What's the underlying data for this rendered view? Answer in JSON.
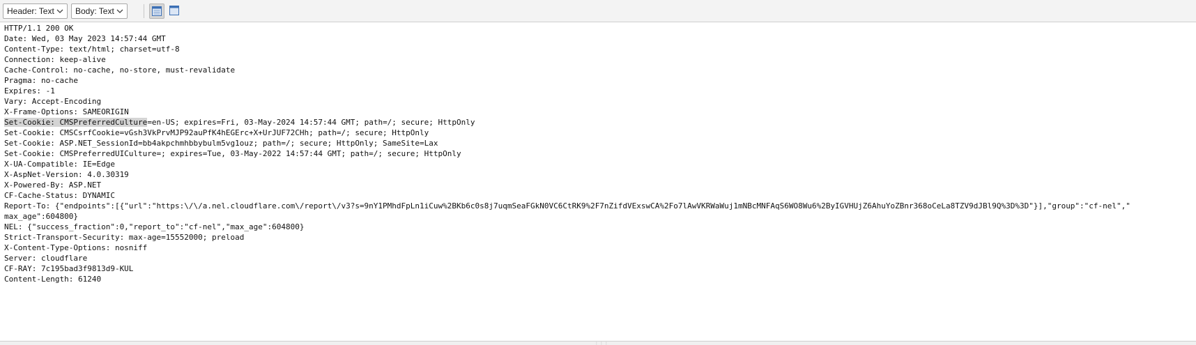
{
  "toolbar": {
    "header_select": "Header: Text",
    "body_select": "Body: Text"
  },
  "response": {
    "line_0": "HTTP/1.1 200 OK",
    "line_1": "Date: Wed, 03 May 2023 14:57:44 GMT",
    "line_2": "Content-Type: text/html; charset=utf-8",
    "line_3": "Connection: keep-alive",
    "line_4": "Cache-Control: no-cache, no-store, must-revalidate",
    "line_5": "Pragma: no-cache",
    "line_6": "Expires: -1",
    "line_7": "Vary: Accept-Encoding",
    "line_8": "X-Frame-Options: SAMEORIGIN",
    "line_9_selected": "Set-Cookie: CMSPreferredCulture",
    "line_9_rest": "=en-US; expires=Fri, 03-May-2024 14:57:44 GMT; path=/; secure; HttpOnly",
    "line_10": "Set-Cookie: CMSCsrfCookie=vGsh3VkPrvMJP92auPfK4hEGErc+X+UrJUF72CHh; path=/; secure; HttpOnly",
    "line_11": "Set-Cookie: ASP.NET_SessionId=bb4akpchmhbbybulm5vg1ouz; path=/; secure; HttpOnly; SameSite=Lax",
    "line_12": "Set-Cookie: CMSPreferredUICulture=; expires=Tue, 03-May-2022 14:57:44 GMT; path=/; secure; HttpOnly",
    "line_13": "X-UA-Compatible: IE=Edge",
    "line_14": "X-AspNet-Version: 4.0.30319",
    "line_15": "X-Powered-By: ASP.NET",
    "line_16": "CF-Cache-Status: DYNAMIC",
    "line_17": "Report-To: {\"endpoints\":[{\"url\":\"https:\\/\\/a.nel.cloudflare.com\\/report\\/v3?s=9nY1PMhdFpLn1iCuw%2BKb6c0s8j7uqmSeaFGkN0VC6CtRK9%2F7nZifdVExswCA%2Fo7lAwVKRWaWuj1mNBcMNFAqS6WO8Wu6%2ByIGVHUjZ6AhuYoZBnr368oCeLa8TZV9dJBl9Q%3D%3D\"}],\"group\":\"cf-nel\",\"",
    "line_18": "max_age\":604800}",
    "line_19": "NEL: {\"success_fraction\":0,\"report_to\":\"cf-nel\",\"max_age\":604800}",
    "line_20": "Strict-Transport-Security: max-age=15552000; preload",
    "line_21": "X-Content-Type-Options: nosniff",
    "line_22": "Server: cloudflare",
    "line_23": "CF-RAY: 7c195bad3f9813d9-KUL",
    "line_24": "Content-Length: 61240"
  }
}
